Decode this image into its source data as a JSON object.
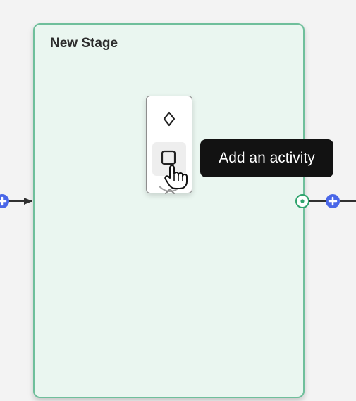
{
  "stage": {
    "title": "New Stage",
    "border_color": "#6fbf9b",
    "background_color": "#eaf6f0"
  },
  "toolbox": {
    "items": [
      {
        "name": "gateway",
        "icon": "diamond-icon"
      },
      {
        "name": "activity",
        "icon": "square-icon"
      }
    ],
    "hover_index": 1,
    "collapse_icon": "chevron-up-icon"
  },
  "tooltip": {
    "text": "Add an activity",
    "background_color": "#121212",
    "text_color": "#ffffff"
  },
  "connectors": {
    "accent_color": "#4a67e8",
    "success_color": "#2fa46d",
    "left_icon": "plus-circle-icon",
    "right_icons": [
      "target-circle-icon",
      "plus-circle-icon"
    ]
  },
  "cursor": {
    "icon": "hand-cursor-icon"
  }
}
